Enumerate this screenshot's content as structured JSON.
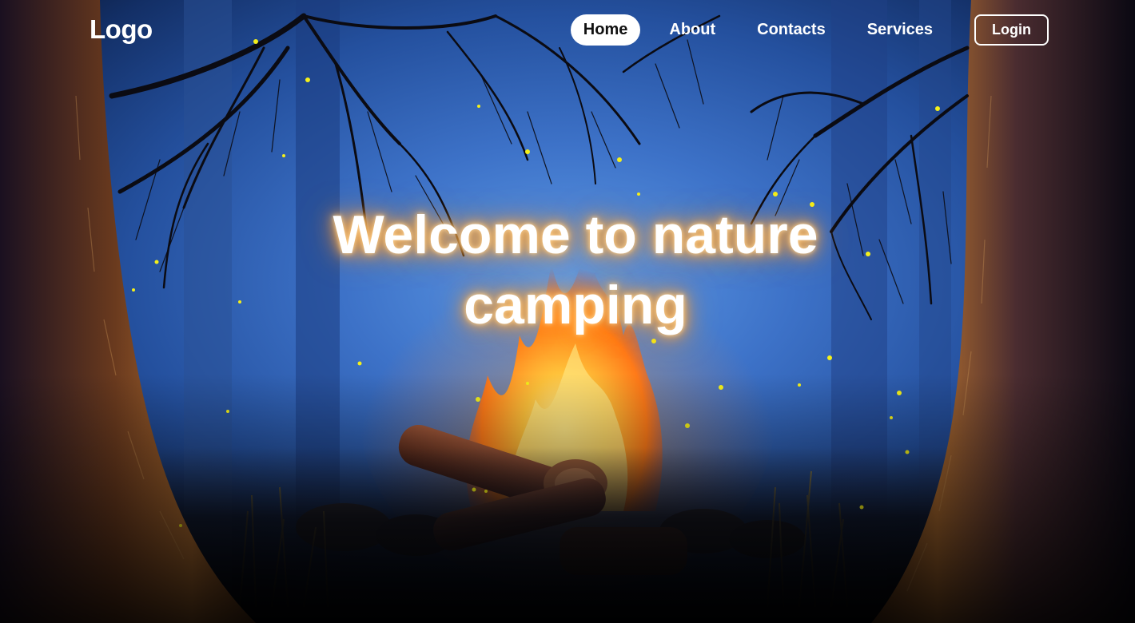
{
  "header": {
    "logo": "Logo",
    "nav": [
      {
        "label": "Home",
        "active": true
      },
      {
        "label": "About",
        "active": false
      },
      {
        "label": "Contacts",
        "active": false
      },
      {
        "label": "Services",
        "active": false
      }
    ],
    "login_label": "Login"
  },
  "hero": {
    "headline": "Welcome to nature camping"
  },
  "colors": {
    "sky_light": "#5f9be6",
    "sky_dark": "#132f66",
    "glow": "#ff9a2a",
    "firefly": "#f4f01a",
    "trunk": "#9a5a2a"
  }
}
